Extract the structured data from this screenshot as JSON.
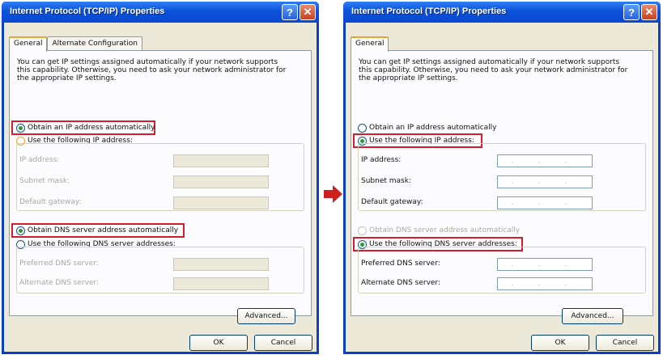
{
  "left": {
    "title": "Internet Protocol (TCP/IP) Properties",
    "help_label": "?",
    "close_label": "✕",
    "tabs": [
      "General",
      "Alternate Configuration"
    ],
    "description": "You can get IP settings assigned automatically if your network supports this capability. Otherwise, you need to ask your network administrator for the appropriate IP settings.",
    "opt_ip_auto": "Obtain an IP address automatically",
    "opt_ip_manual": "Use the following IP address:",
    "ip_label": "IP address:",
    "subnet_label": "Subnet mask:",
    "gateway_label": "Default gateway:",
    "opt_dns_auto": "Obtain DNS server address automatically",
    "opt_dns_manual": "Use the following DNS server addresses:",
    "preferred_dns_label": "Preferred DNS server:",
    "alternate_dns_label": "Alternate DNS server:",
    "advanced_label": "Advanced...",
    "ok_label": "OK",
    "cancel_label": "Cancel"
  },
  "right": {
    "title": "Internet Protocol (TCP/IP) Properties",
    "help_label": "?",
    "close_label": "✕",
    "tabs": [
      "General"
    ],
    "description": "You can get IP settings assigned automatically if your network supports this capability. Otherwise, you need to ask your network administrator for the appropriate IP settings.",
    "opt_ip_auto": "Obtain an IP address automatically",
    "opt_ip_manual": "Use the following IP address:",
    "ip_label": "IP address:",
    "subnet_label": "Subnet mask:",
    "gateway_label": "Default gateway:",
    "ip_dots": ". . .",
    "opt_dns_auto": "Obtain DNS server address automatically",
    "opt_dns_manual": "Use the following DNS server addresses:",
    "preferred_dns_label": "Preferred DNS server:",
    "alternate_dns_label": "Alternate DNS server:",
    "advanced_label": "Advanced...",
    "ok_label": "OK",
    "cancel_label": "Cancel"
  },
  "colors": {
    "highlight": "#d21d2d",
    "arrow": "#cc1f1f",
    "titlebar": "#0b52d9",
    "dialog_bg": "#ece9d8"
  },
  "icons": [
    "arrow-right-icon"
  ]
}
